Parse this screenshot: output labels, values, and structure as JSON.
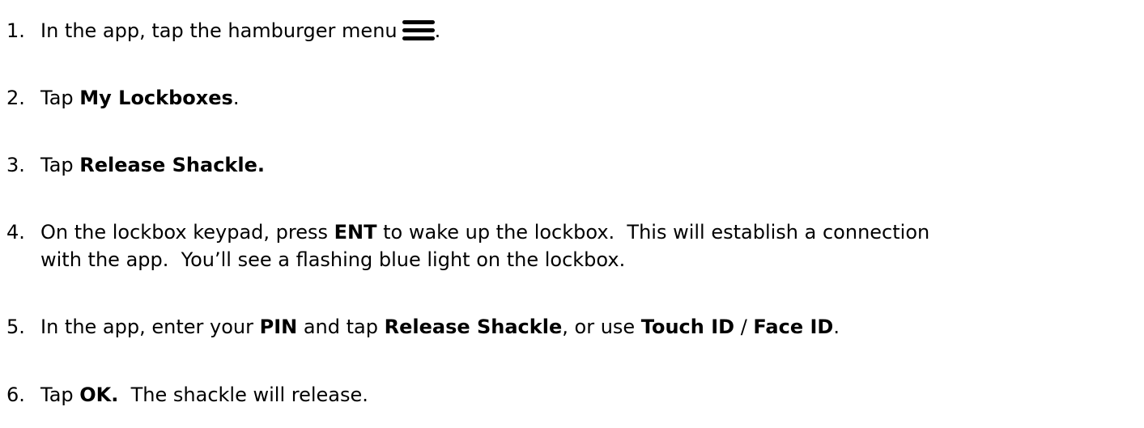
{
  "steps": [
    {
      "number": "1.",
      "before": "In the app, tap the hamburger menu",
      "icon": "hamburger-menu-icon",
      "after": "."
    },
    {
      "number": "2.",
      "before": "Tap ",
      "bold": "My Lockboxes",
      "after": "."
    },
    {
      "number": "3.",
      "before": "Tap ",
      "bold": "Release Shackle."
    },
    {
      "number": "4.",
      "before": "On the lockbox keypad, press ",
      "bold": "ENT",
      "after": " to wake up the lockbox.  This will establish a connection",
      "line2": "with the app.  You’ll see a flashing blue light on the lockbox."
    },
    {
      "number": "5.",
      "t1": "In the app, enter your ",
      "b1": "PIN",
      "t2": " and tap ",
      "b2": "Release Shackle",
      "t3": ", or use ",
      "b3": "Touch ID",
      "t4": " / ",
      "b4": "Face ID",
      "t5": "."
    },
    {
      "number": "6.",
      "before": "Tap ",
      "bold": "OK.",
      "after": "  The shackle will release."
    }
  ]
}
